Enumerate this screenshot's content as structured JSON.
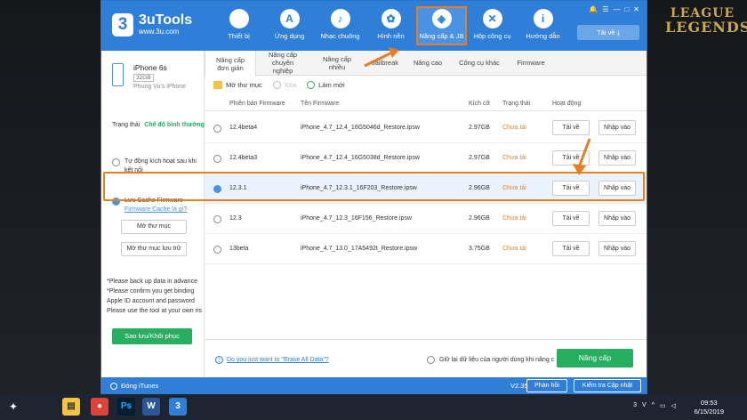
{
  "header": {
    "brand_name": "3uTools",
    "brand_url": "www.3u.com",
    "nav": [
      {
        "label": "Thiết bị",
        "icon": "apple-icon"
      },
      {
        "label": "Ứng dụng",
        "icon": "appstore-icon"
      },
      {
        "label": "Nhạc chuông",
        "icon": "bell-icon"
      },
      {
        "label": "Hình nền",
        "icon": "flower-icon"
      },
      {
        "label": "Nâng cấp & JB",
        "icon": "dropbox-icon"
      },
      {
        "label": "Hộp công cụ",
        "icon": "tools-icon"
      },
      {
        "label": "Hướng dẫn",
        "icon": "info-icon"
      }
    ],
    "download_label": "Tải về"
  },
  "sidebar": {
    "device_name": "iPhone 6s",
    "capacity": "32GB",
    "owner": "Phung Vu's iPhone",
    "status_label": "Trạng thái",
    "status_value": "Chế độ bình thường",
    "auto_activate": "Tự động kích hoạt sau khi kết nối",
    "cache_label": "Lưu Cache Firmware",
    "cache_link": "Firmware Cache là gì?",
    "open_folder": "Mở thư mục",
    "open_save_folder": "Mở thư mục lưu trữ",
    "notes": [
      "*Please back up data in advance",
      "*Please confirm you get binding",
      "Apple ID account and password",
      "Please use the tool at your own ris"
    ],
    "backup_button": "Sao lưu/Khôi phục"
  },
  "tabs": [
    "Nâng cấp đơn giản",
    "Nâng cấp chuyên nghiệp",
    "Nâng cấp nhiều",
    "Jailbreak",
    "Nâng cao",
    "Công cụ khác",
    "Firmware"
  ],
  "toolbar": {
    "open_folder": "Mở thư mục",
    "delete": "Xóa",
    "refresh": "Làm mới"
  },
  "table": {
    "headers": {
      "version": "Phiên bản Firmware",
      "name": "Tên Firmware",
      "size": "Kích cỡ",
      "status": "Trạng thái",
      "action": "Hoạt động"
    },
    "rows": [
      {
        "version": "12.4beta4",
        "name": "iPhone_4.7_12.4_16G5046d_Restore.ipsw",
        "size": "2.97GB",
        "status": "Chưa tải",
        "download": "Tải về",
        "import": "Nhập vào",
        "selected": false
      },
      {
        "version": "12.4beta3",
        "name": "iPhone_4.7_12.4_16G5038d_Restore.ipsw",
        "size": "2.97GB",
        "status": "Chưa tải",
        "download": "Tải về",
        "import": "Nhập vào",
        "selected": false
      },
      {
        "version": "12.3.1",
        "name": "iPhone_4.7_12.3.1_16F203_Restore.ipsw",
        "size": "2.96GB",
        "status": "Chưa tải",
        "download": "Tải về",
        "import": "Nhập vào",
        "selected": true
      },
      {
        "version": "12.3",
        "name": "iPhone_4.7_12.3_16F156_Restore.ipsw",
        "size": "2.96GB",
        "status": "Chưa tải",
        "download": "Tải về",
        "import": "Nhập vào",
        "selected": false
      },
      {
        "version": "13beta",
        "name": "iPhone_4.7_13.0_17A5492t_Restore.ipsw",
        "size": "3.75GB",
        "status": "Chưa tải",
        "download": "Tải về",
        "import": "Nhập vào",
        "selected": false
      }
    ]
  },
  "bottom": {
    "erase_link": "Do you just want to \"Erase All Data\"?",
    "keep_data": "Giữ lại dữ liệu của người dùng khi nâng c",
    "upgrade_button": "Nâng cấp"
  },
  "footer": {
    "itunes": "Đóng iTunes",
    "version": "V2.35",
    "feedback": "Phản hồi",
    "check_update": "Kiểm tra Cập nhật"
  },
  "desktop": {
    "logo_line1": "LEAGUE",
    "logo_line2": "LEGENDS",
    "clock_time": "09:53",
    "clock_date": "6/15/2019"
  },
  "colors": {
    "brand_blue": "#2f7fd8",
    "highlight_orange": "#e67e22",
    "success_green": "#27ae60"
  }
}
